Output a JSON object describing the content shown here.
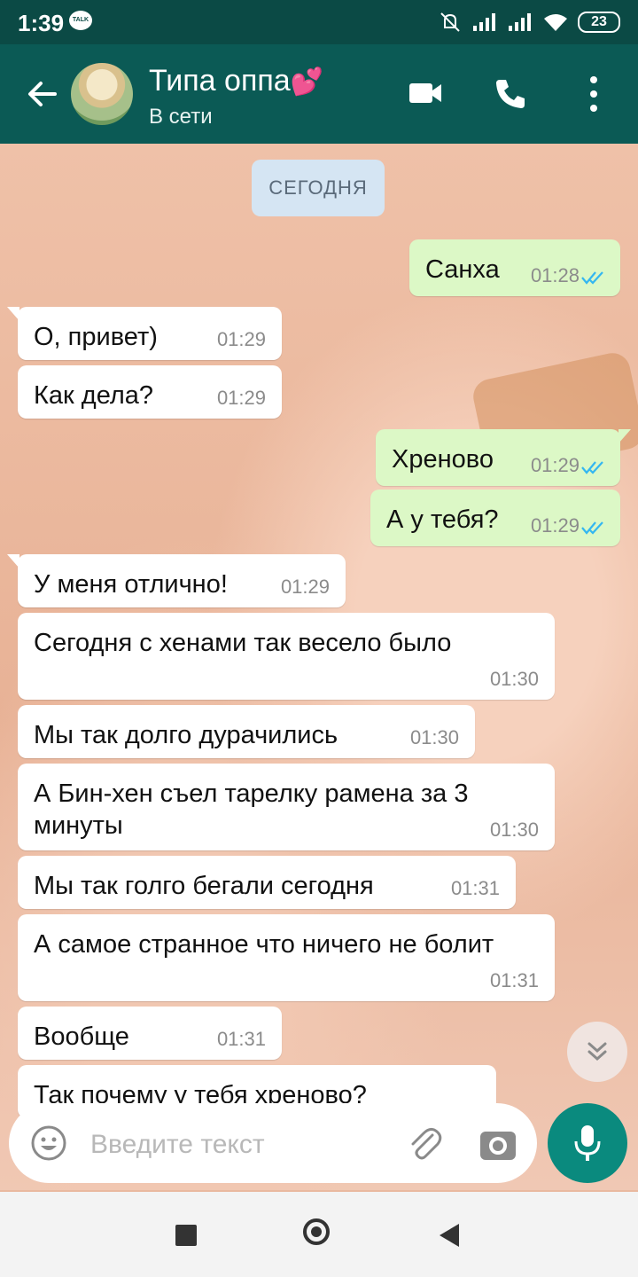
{
  "status_bar": {
    "time": "1:39",
    "talk_badge": "TALK",
    "battery": "23"
  },
  "header": {
    "contact_name": "Типа оппа",
    "heart_emoji": "💕",
    "status": "В сети"
  },
  "chat": {
    "date_chip": "СЕГОДНЯ",
    "messages": [
      {
        "dir": "out",
        "text": "Санха",
        "time": "01:28",
        "read": true
      },
      {
        "dir": "in",
        "text": "О, привет)",
        "time": "01:29"
      },
      {
        "dir": "in",
        "text": "Как дела?",
        "time": "01:29"
      },
      {
        "dir": "out",
        "text": "Хреново",
        "time": "01:29",
        "read": true
      },
      {
        "dir": "out",
        "text": "А у тебя?",
        "time": "01:29",
        "read": true
      },
      {
        "dir": "in",
        "text": "У меня отлично!",
        "time": "01:29"
      },
      {
        "dir": "in",
        "text": "Сегодня с хенами так весело было",
        "time": "01:30"
      },
      {
        "dir": "in",
        "text": "Мы так долго дурачились",
        "time": "01:30"
      },
      {
        "dir": "in",
        "text": "А Бин-хен съел тарелку рамена за 3 минуты",
        "time": "01:30"
      },
      {
        "dir": "in",
        "text": "Мы так голго бегали сегодня",
        "time": "01:31"
      },
      {
        "dir": "in",
        "text": "А самое странное что ничего не болит",
        "time": "01:31"
      },
      {
        "dir": "in",
        "text": "Вообще",
        "time": "01:31"
      },
      {
        "dir": "in",
        "text": "Так почему у тебя хреново?",
        "time": ""
      }
    ]
  },
  "composer": {
    "placeholder": "Введите текст"
  },
  "colors": {
    "header": "#0b5a55",
    "status_bar": "#0b4a45",
    "outgoing_bubble": "#dcf8c6",
    "incoming_bubble": "#ffffff",
    "mic_button": "#0a8a7e",
    "read_ticks": "#34b7f1"
  }
}
